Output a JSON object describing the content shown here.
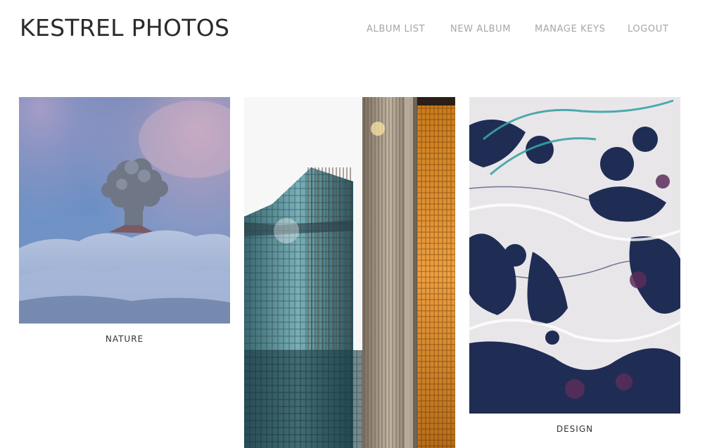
{
  "header": {
    "brand": "KESTREL PHOTOS",
    "nav": [
      {
        "label": "ALBUM LIST"
      },
      {
        "label": "NEW ALBUM"
      },
      {
        "label": "MANAGE KEYS"
      },
      {
        "label": "LOGOUT"
      }
    ]
  },
  "albums": [
    {
      "caption": "NATURE",
      "image": "volcano-eruption-clouds-photo"
    },
    {
      "caption": "",
      "image": "glass-skyscrapers-photo"
    },
    {
      "caption": "DESIGN",
      "image": "marbled-ink-pattern-photo"
    }
  ],
  "colors": {
    "text": "#2b2b2b",
    "nav_text": "#a6a6a6",
    "background": "#ffffff"
  }
}
